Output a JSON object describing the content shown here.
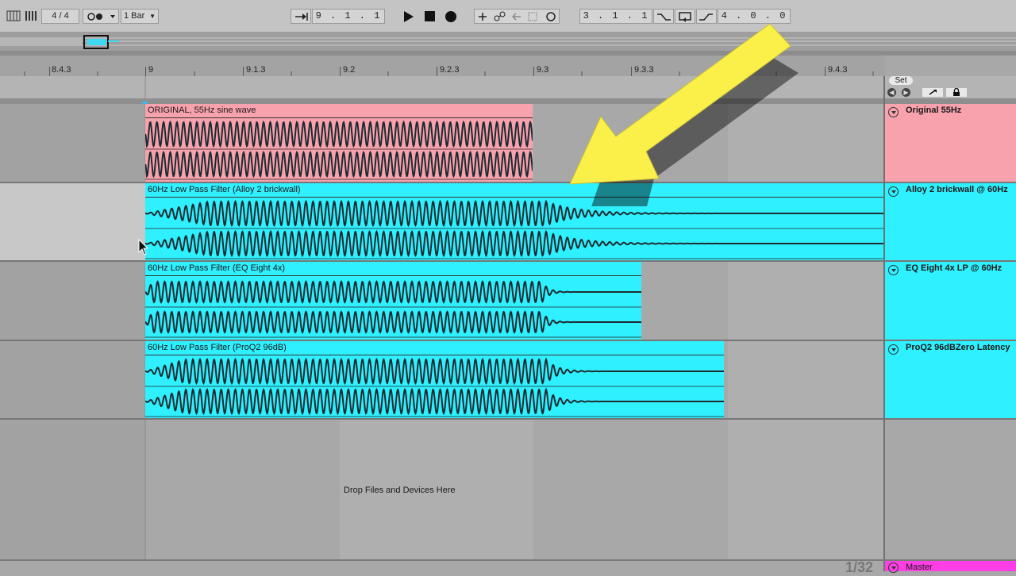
{
  "toolbar": {
    "time_signature": "4 / 4",
    "quantize": "1 Bar",
    "arrangement_position": "9 .  1 .  1",
    "loop_start": "3 .  1 .  1",
    "loop_length": "4 .  0 .  0"
  },
  "ruler": {
    "labels": [
      "8.4.3",
      "9",
      "9.1.3",
      "9.2",
      "9.2.3",
      "9.3",
      "9.3.3",
      "9.4.3"
    ]
  },
  "right_panel": {
    "set_label": "Set"
  },
  "tracks": [
    {
      "name": "Original 55Hz",
      "clip_title": "ORIGINAL, 55Hz sine wave",
      "color": "#f7a2ad"
    },
    {
      "name": "Alloy 2 brickwall @ 60Hz",
      "clip_title": "60Hz Low Pass Filter (Alloy 2 brickwall)",
      "color": "#2ff0ff"
    },
    {
      "name": "EQ Eight 4x LP @ 60Hz",
      "clip_title": "60Hz Low Pass Filter (EQ Eight 4x)",
      "color": "#2ff0ff"
    },
    {
      "name": "ProQ2 96dBZero Latency",
      "clip_title": "60Hz Low Pass Filter (ProQ2 96dB)",
      "color": "#2ff0ff"
    }
  ],
  "drop_zone": "Drop Files and Devices Here",
  "master": {
    "name": "Master",
    "color": "#ff3ee6"
  },
  "zoom": "1/32",
  "overlay": {
    "arrow_color": "#fbf04a"
  }
}
